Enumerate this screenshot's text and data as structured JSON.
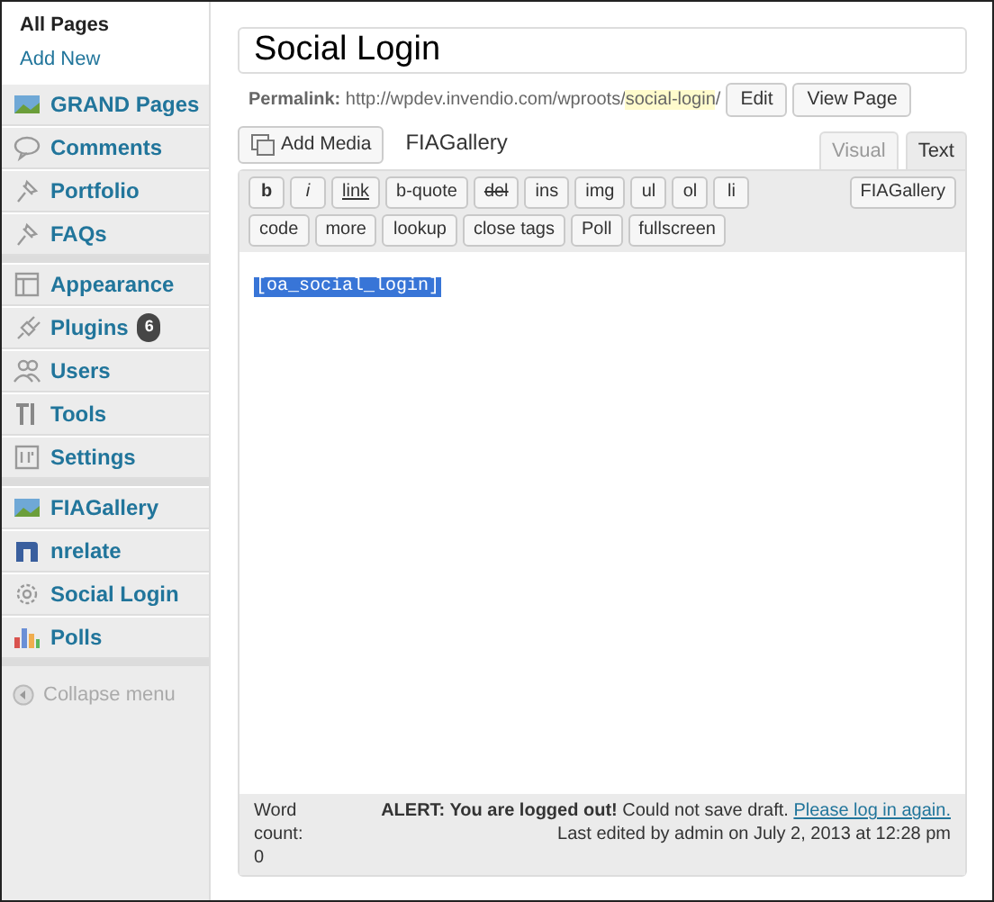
{
  "sidebar": {
    "submenu": [
      {
        "label": "All Pages",
        "selected": true
      },
      {
        "label": "Add New",
        "selected": false
      }
    ],
    "groups": [
      [
        {
          "label": "GRAND Pages"
        },
        {
          "label": "Comments"
        },
        {
          "label": "Portfolio"
        },
        {
          "label": "FAQs"
        }
      ],
      [
        {
          "label": "Appearance"
        },
        {
          "label": "Plugins",
          "badge": "6"
        },
        {
          "label": "Users"
        },
        {
          "label": "Tools"
        },
        {
          "label": "Settings"
        }
      ],
      [
        {
          "label": "FIAGallery"
        },
        {
          "label": "nrelate"
        },
        {
          "label": "Social Login"
        },
        {
          "label": "Polls"
        }
      ]
    ],
    "collapse": "Collapse menu"
  },
  "title": "Social Login",
  "permalink": {
    "label": "Permalink:",
    "url": "http://wpdev.invendio.com/wproots/",
    "slug": "social-login",
    "trail": "/",
    "buttons": [
      "Edit",
      "View Page"
    ]
  },
  "media": {
    "add_media": "Add Media",
    "gallery": "FIAGallery"
  },
  "editor_tabs": [
    {
      "label": "Visual",
      "selected": false
    },
    {
      "label": "Text",
      "selected": true
    }
  ],
  "quicktags": [
    {
      "label": "b",
      "kind": "bold"
    },
    {
      "label": "i",
      "kind": "italic"
    },
    {
      "label": "link",
      "kind": "link"
    },
    {
      "label": "b-quote",
      "kind": "plain"
    },
    {
      "label": "del",
      "kind": "strike"
    },
    {
      "label": "ins",
      "kind": "plain"
    },
    {
      "label": "img",
      "kind": "plain"
    },
    {
      "label": "ul",
      "kind": "plain"
    },
    {
      "label": "ol",
      "kind": "plain"
    },
    {
      "label": "li",
      "kind": "plain"
    },
    {
      "label": "code",
      "kind": "plain"
    },
    {
      "label": "more",
      "kind": "plain"
    },
    {
      "label": "lookup",
      "kind": "plain"
    },
    {
      "label": "close tags",
      "kind": "plain"
    },
    {
      "label": "Poll",
      "kind": "plain"
    },
    {
      "label": "fullscreen",
      "kind": "plain"
    }
  ],
  "quicktag_right": "FIAGallery",
  "content": "[oa_social_login]",
  "status": {
    "word_count": "Word count:",
    "count": "0",
    "alert": "**ALERT: You are logged out!** Could not save draft.",
    "link": "Please log in again.",
    "rest": "Last edited by admin on July 2, 2013 at 12:28 pm"
  }
}
